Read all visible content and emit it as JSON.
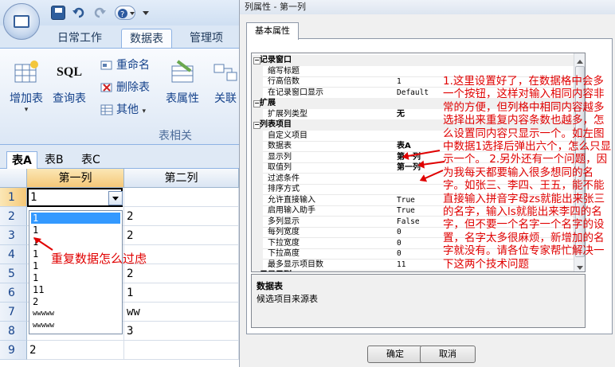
{
  "app": {
    "quick_access": [
      "save-icon",
      "undo-icon",
      "redo-icon",
      "help-icon"
    ],
    "ribbon_tabs": [
      "日常工作",
      "数据表",
      "管理项目"
    ],
    "active_tab": "数据表",
    "ribbon": {
      "add_table": "增加表",
      "query_table": "查询表",
      "sql_label": "SQL",
      "rename": "重命名",
      "delete_table": "删除表",
      "other": "其他",
      "table_props": "表属性",
      "relations": "关联",
      "group_label": "表相关"
    },
    "sheet_tabs": [
      "表A",
      "表B",
      "表C"
    ],
    "active_sheet": "表A",
    "columns": [
      "第一列",
      "第二列"
    ],
    "rows": [
      {
        "num": "1",
        "c1": "1",
        "c2": ""
      },
      {
        "num": "2",
        "c1": "",
        "c2": "2"
      },
      {
        "num": "3",
        "c1": "",
        "c2": "2"
      },
      {
        "num": "4",
        "c1": "",
        "c2": ""
      },
      {
        "num": "5",
        "c1": "",
        "c2": "2"
      },
      {
        "num": "6",
        "c1": "",
        "c2": "1"
      },
      {
        "num": "7",
        "c1": "",
        "c2": "ww"
      },
      {
        "num": "8",
        "c1": "1",
        "c2": "3"
      },
      {
        "num": "9",
        "c1": "2",
        "c2": ""
      }
    ],
    "dropdown_items": [
      "1",
      "1",
      "1",
      "1",
      "1",
      "1",
      "11",
      "2",
      "wwwww",
      "wwwww"
    ],
    "dropdown_selected_index": 0,
    "grid_note": "重复数据怎么过虑"
  },
  "dialog": {
    "title": "列属性 - 第一列",
    "tab": "基本属性",
    "properties": [
      {
        "type": "cat",
        "key": "记录窗口",
        "toggle": "−"
      },
      {
        "type": "row",
        "key": "缩写标题",
        "value": ""
      },
      {
        "type": "row",
        "key": "行高倍数",
        "value": "1"
      },
      {
        "type": "row",
        "key": "在记录窗口显示",
        "value": "Default"
      },
      {
        "type": "cat",
        "key": "扩展",
        "toggle": "−"
      },
      {
        "type": "row",
        "key": "扩展列类型",
        "value": "无",
        "bold": true
      },
      {
        "type": "cat",
        "key": "列表项目",
        "toggle": "−"
      },
      {
        "type": "row",
        "key": "自定义项目",
        "value": ""
      },
      {
        "type": "row",
        "key": "数据表",
        "value": "表A",
        "bold": true
      },
      {
        "type": "row",
        "key": "显示列",
        "value": "第一列",
        "bold": true
      },
      {
        "type": "row",
        "key": "取值列",
        "value": "第一列",
        "bold": true
      },
      {
        "type": "row",
        "key": "过滤条件",
        "value": ""
      },
      {
        "type": "row",
        "key": "排序方式",
        "value": ""
      },
      {
        "type": "row",
        "key": "允许直接输入",
        "value": "True"
      },
      {
        "type": "row",
        "key": "启用输入助手",
        "value": "True"
      },
      {
        "type": "row",
        "key": "多列显示",
        "value": "False"
      },
      {
        "type": "row",
        "key": "每列宽度",
        "value": "0"
      },
      {
        "type": "row",
        "key": "下拉宽度",
        "value": "0"
      },
      {
        "type": "row",
        "key": "下拉高度",
        "value": "0"
      },
      {
        "type": "row",
        "key": "最多显示项目数",
        "value": "11"
      },
      {
        "type": "cat",
        "key": "只显示列",
        "toggle": "−"
      }
    ],
    "description_title": "数据表",
    "description_text": "候选项目来源表",
    "ok_label": "确定",
    "cancel_label": "取消"
  },
  "annotation": "1.这里设置好了，在数据格中会多一个按钮，这样对输入相同内容非常的方便，但列格中相同内容越多选择出来重复内容条数也越多，怎么设置同内容只显示一个。如左图中数据1选择后弹出六个，怎么只显示一个。 2.另外还有一个问题，因为我每天都要输入很多想同的名字。如张三、李四、王五，能不能直接输入拼音字母zs就能出来张三的名字，输入ls就能出来李四的名字，但不要一个名字一个名字的设置，名字太多很麻烦，新增加的名字就没有。请各位专家帮忙解决一下这两个技术问题",
  "colors": {
    "accent_red": "#e00000",
    "ribbon_blue": "#15428b",
    "selection_blue": "#3399ff",
    "selected_header": "#f5c878"
  }
}
